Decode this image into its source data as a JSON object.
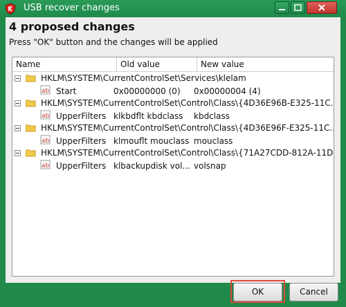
{
  "window": {
    "title": "USB recover changes",
    "controls": [
      "minimize-icon",
      "maximize-icon",
      "close-icon"
    ]
  },
  "dialog": {
    "heading": "4 proposed changes",
    "instruction": "Press \"OK\" button and the changes will be applied"
  },
  "tree": {
    "columns": [
      "Name",
      "Old value",
      "New value"
    ],
    "keys": [
      {
        "path": "HKLM\\SYSTEM\\CurrentControlSet\\Services\\klelam",
        "value": {
          "name": "Start",
          "old": "0x00000000 (0)",
          "new": "0x00000004 (4)"
        }
      },
      {
        "path": "HKLM\\SYSTEM\\CurrentControlSet\\Control\\Class\\{4D36E96B-E325-11C...",
        "value": {
          "name": "UpperFilters",
          "old": "klkbdflt kbdclass",
          "new": "kbdclass"
        }
      },
      {
        "path": "HKLM\\SYSTEM\\CurrentControlSet\\Control\\Class\\{4D36E96F-E325-11C...",
        "value": {
          "name": "UpperFilters",
          "old": "klmouflt mouclass",
          "new": "mouclass"
        }
      },
      {
        "path": "HKLM\\SYSTEM\\CurrentControlSet\\Control\\Class\\{71A27CDD-812A-11D...",
        "value": {
          "name": "UpperFilters",
          "old": "klbackupdisk vol...",
          "new": "volsnap"
        }
      }
    ]
  },
  "buttons": {
    "ok": "OK",
    "cancel": "Cancel"
  },
  "colors": {
    "frame": "#1f8a4a",
    "highlight": "#e0483d"
  }
}
